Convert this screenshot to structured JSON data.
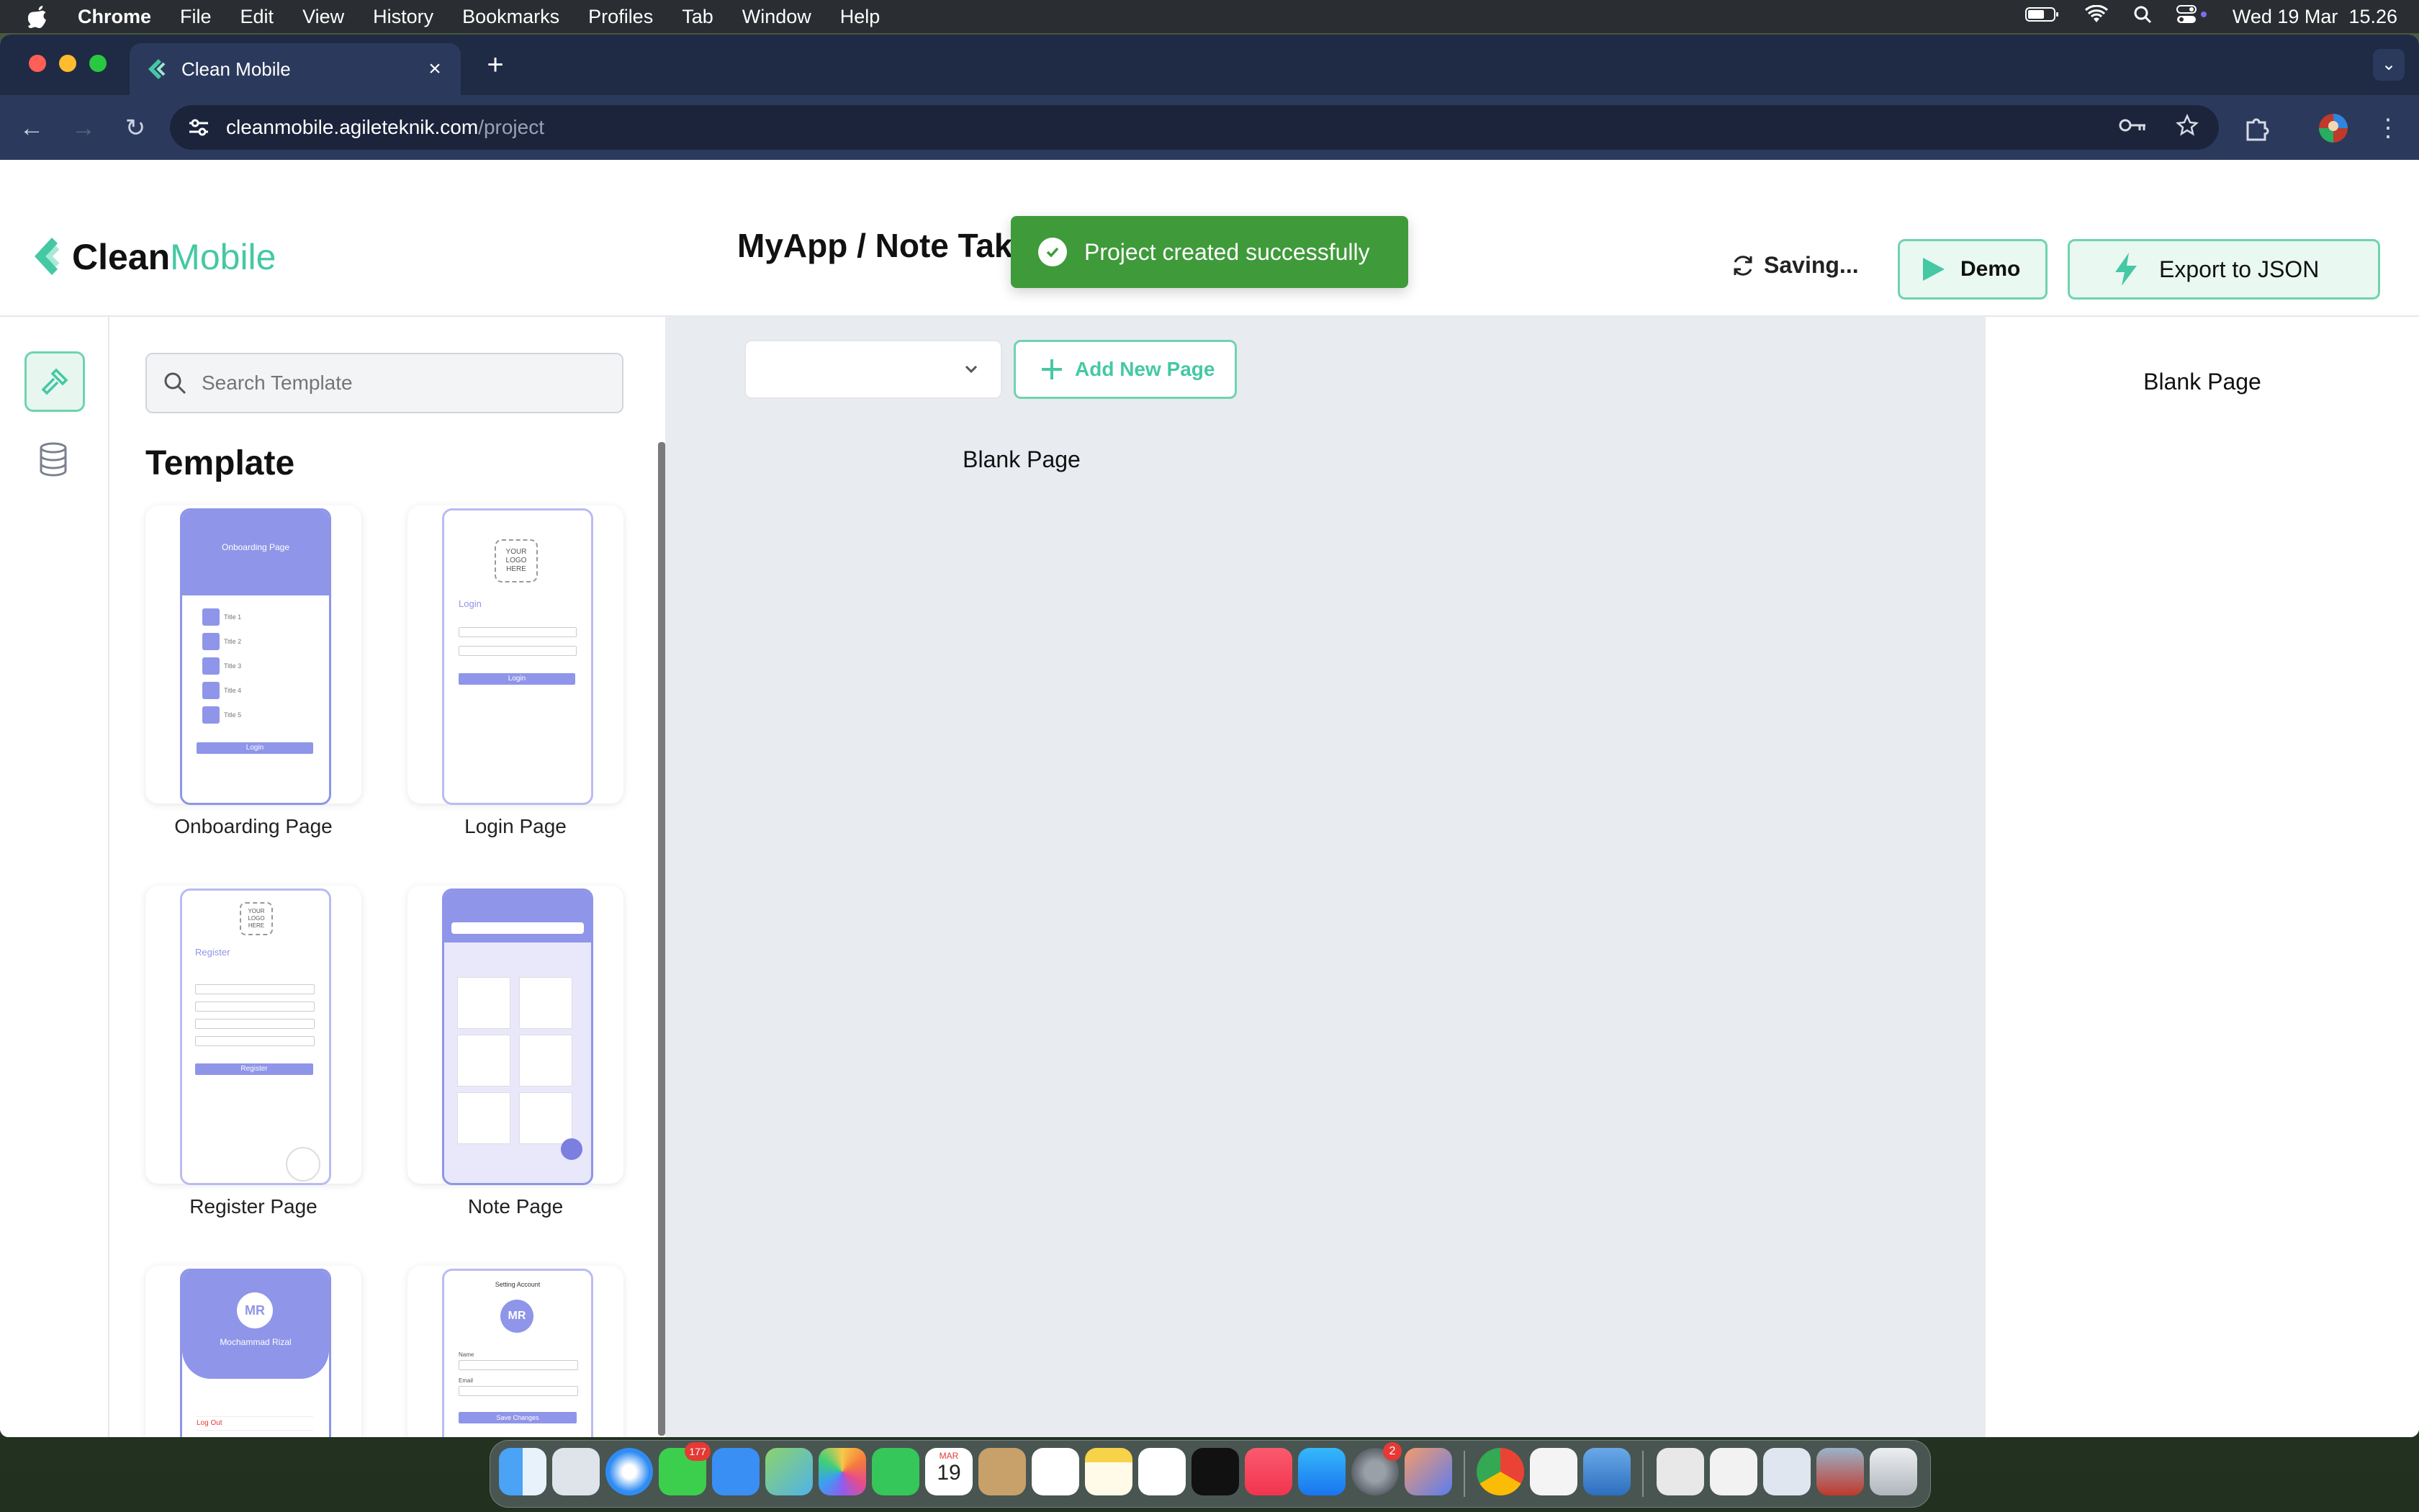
{
  "menubar": {
    "app_name": "Chrome",
    "items": [
      "File",
      "Edit",
      "View",
      "History",
      "Bookmarks",
      "Profiles",
      "Tab",
      "Window",
      "Help"
    ],
    "clock": "Wed 19 Mar  15.26"
  },
  "browser": {
    "tab_title": "Clean Mobile",
    "url_host": "cleanmobile.agileteknik.com",
    "url_path": "/project"
  },
  "app": {
    "logo": {
      "part1": "Clean",
      "part2": "Mobile"
    },
    "project_title": "MyApp / Note Taking",
    "toast_message": "Project created successfully",
    "saving_label": "Saving...",
    "demo_label": "Demo",
    "export_label": "Export to JSON",
    "search_placeholder": "Search Template",
    "template_heading": "Template",
    "templates": [
      {
        "label": "Onboarding Page",
        "preview": "onboarding"
      },
      {
        "label": "Login Page",
        "preview": "login"
      },
      {
        "label": "Register Page",
        "preview": "register"
      },
      {
        "label": "Note Page",
        "preview": "note"
      },
      {
        "label": "",
        "preview": "profile"
      },
      {
        "label": "",
        "preview": "setting-account"
      }
    ],
    "previews": {
      "onboarding_header": "Onboarding Page",
      "onboarding_titles": [
        "Title 1",
        "Title 2",
        "Title 3",
        "Title 4",
        "Title 5"
      ],
      "onboarding_button": "Login",
      "logo_placeholder": [
        "YOUR",
        "LOGO",
        "HERE"
      ],
      "login_title": "Login",
      "login_button": "Login",
      "register_title": "Register",
      "register_button": "Register",
      "profile_initials": "MR",
      "profile_name": "Mochammad Rizal",
      "profile_logout": "Log Out",
      "setting_title": "Setting Account",
      "setting_button": "Save Changes",
      "setting_name_label": "Name",
      "setting_email_label": "Email"
    },
    "canvas_title": "Blank Page",
    "add_page_label": "Add New Page",
    "page_select_value": "",
    "right_panel_title": "Blank Page"
  },
  "colors": {
    "accent": "#45c8a4",
    "accent_border": "#6fd3b0",
    "toast_bg": "#3f9a3a",
    "template_purple": "#8f95e8"
  },
  "dock": {
    "messages_badge": "177",
    "calendar_month": "MAR",
    "calendar_day": "19",
    "settings_badge": "2"
  }
}
